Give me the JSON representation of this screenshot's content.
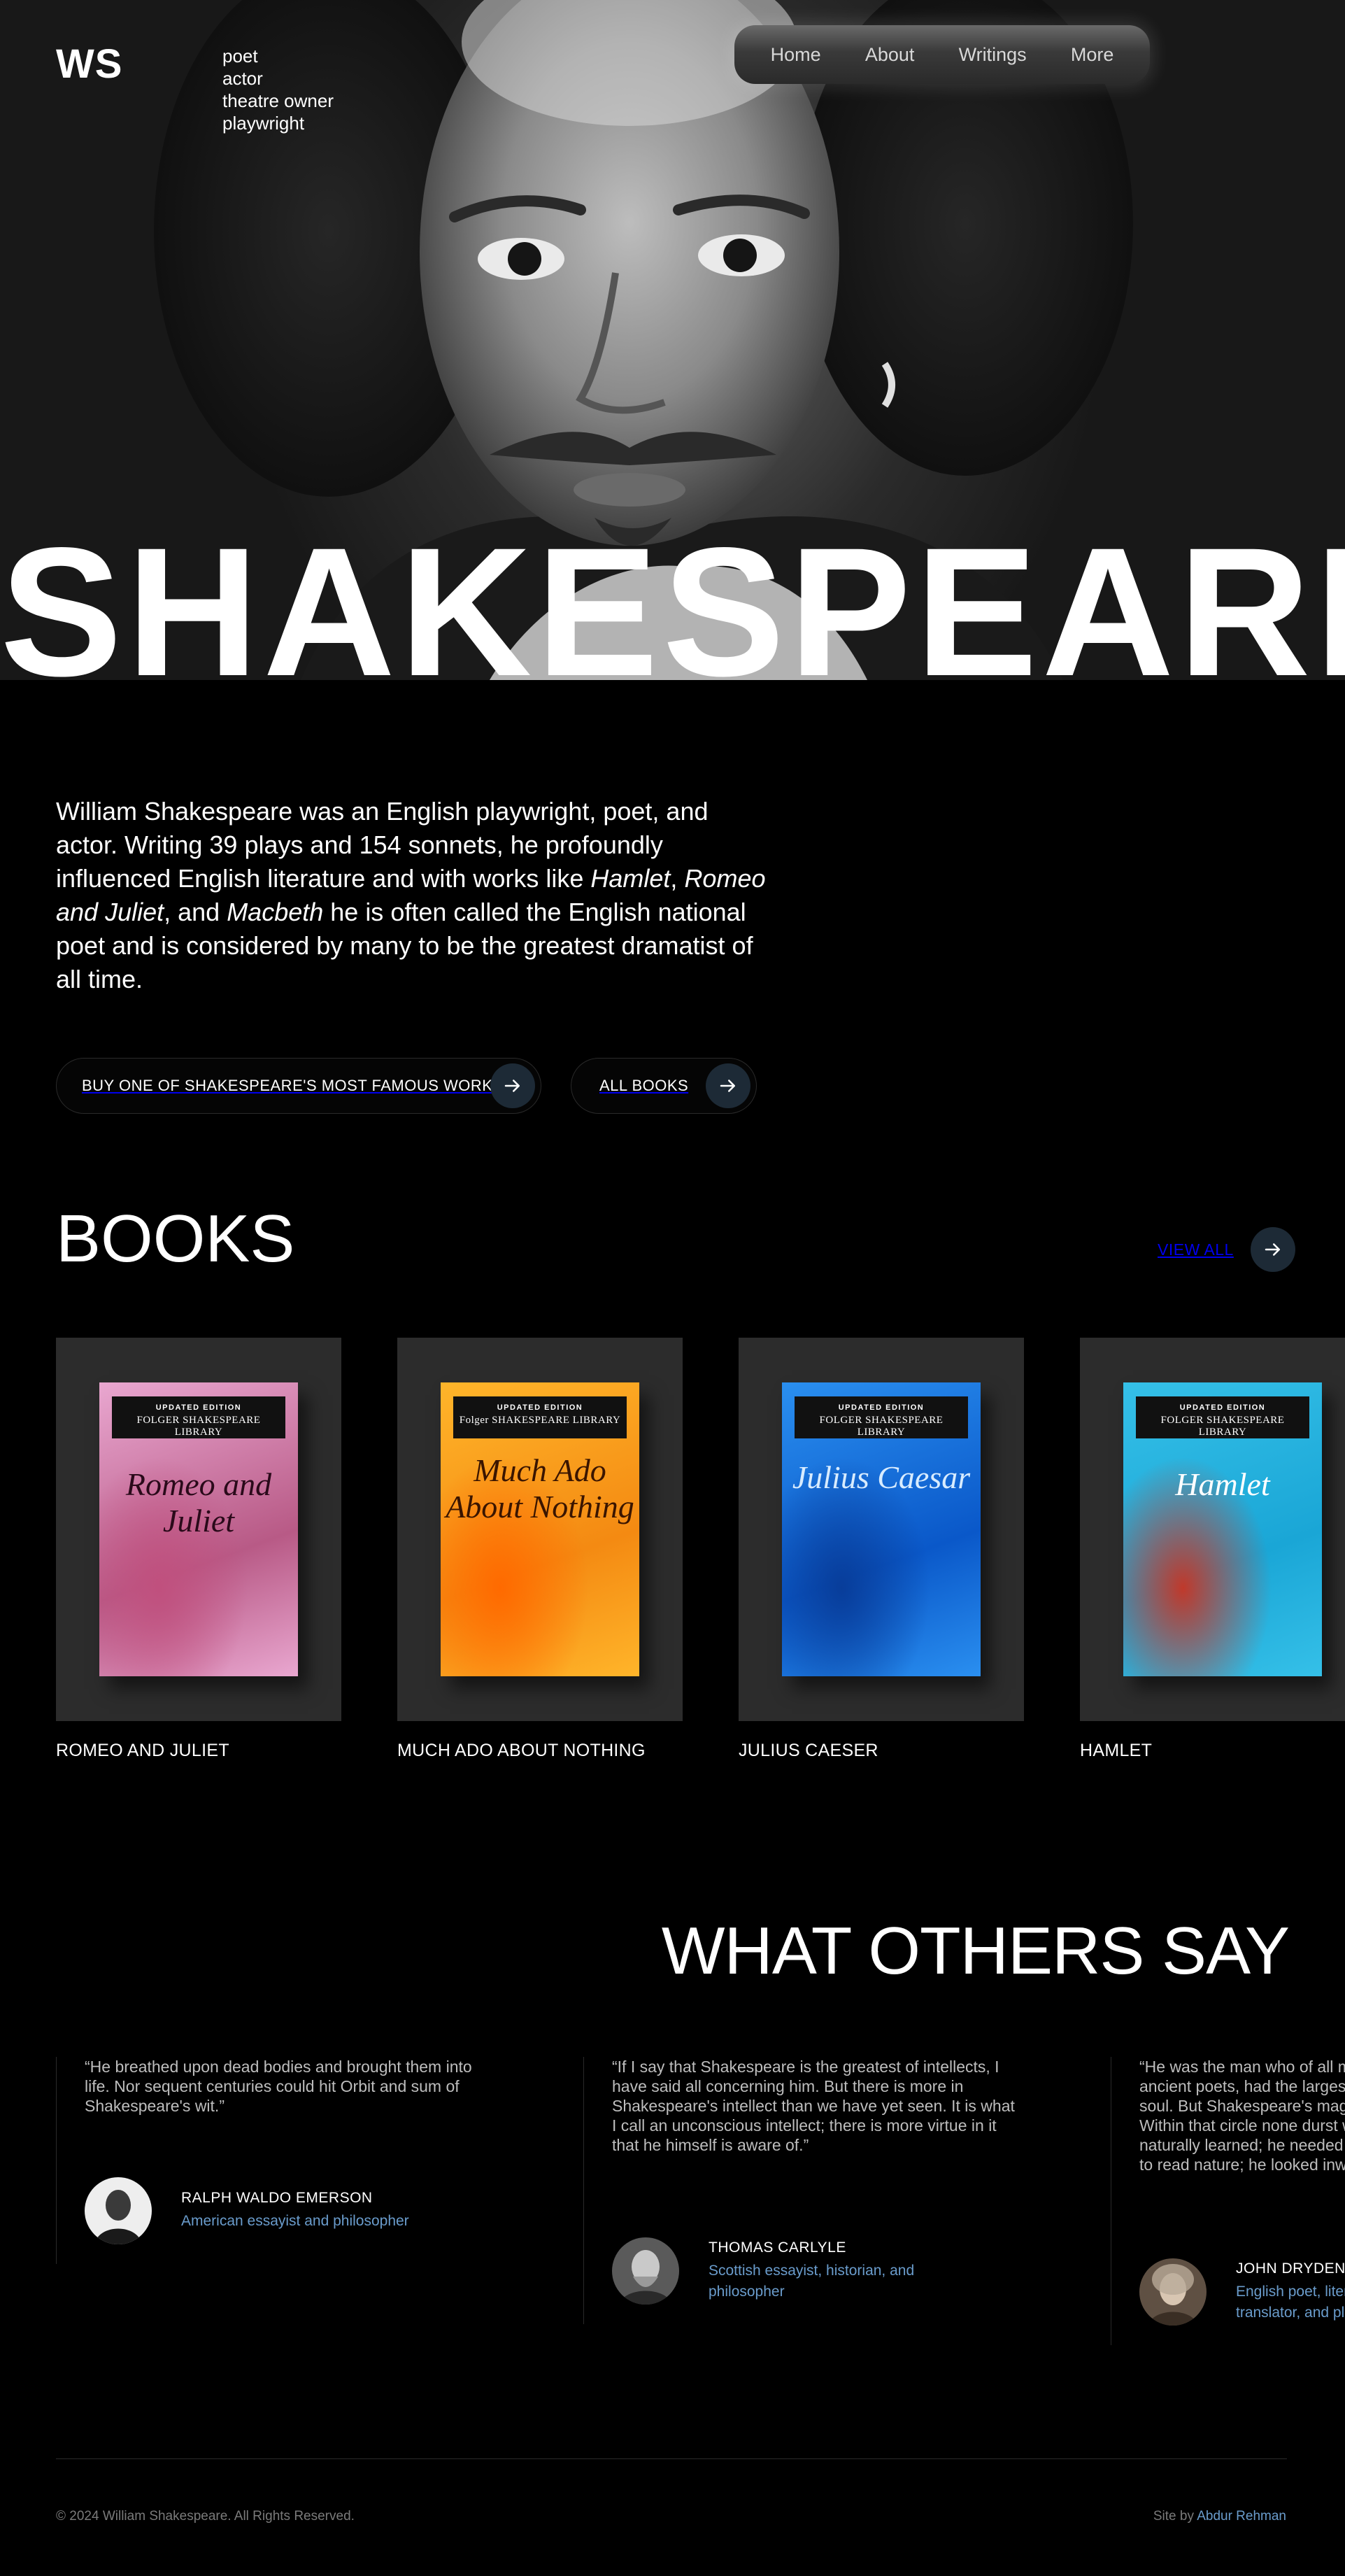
{
  "header": {
    "logo": "WS",
    "roles": [
      "poet",
      "actor",
      "theatre owner",
      "playwright"
    ],
    "nav": [
      "Home",
      "About",
      "Writings",
      "More"
    ]
  },
  "hero": {
    "wordmark": "SHAKESPEARE"
  },
  "intro": {
    "text_1": "William Shakespeare was an English playwright, poet, and actor. Writing 39 plays and 154 sonnets, he profoundly influenced English literature and with works like ",
    "work_1": "Hamlet",
    "sep_1": ", ",
    "work_2": "Romeo and Juliet",
    "sep_2": ", and ",
    "work_3": "Macbeth",
    "text_2": " he is often called the English national poet and is considered by many to be the greatest dramatist of all time."
  },
  "cta": {
    "buy_label": "BUY ONE OF SHAKESPEARE'S MOST FAMOUS WORK",
    "all_books_label": "ALL BOOKS"
  },
  "books": {
    "title": "BOOKS",
    "view_all": "VIEW ALL",
    "items": [
      {
        "name": "ROMEO AND JULIET",
        "cover_title": "Romeo and Juliet",
        "cover_edition": "UPDATED EDITION",
        "cover_series": "FOLGER SHAKESPEARE LIBRARY",
        "cover_colors": [
          "#b85a86",
          "#e9a7d0",
          "#c0507e"
        ]
      },
      {
        "name": "MUCH ADO ABOUT NOTHING",
        "cover_title": "Much Ado About Nothing",
        "cover_edition": "UPDATED EDITION",
        "cover_series": "Folger SHAKESPEARE LIBRARY",
        "cover_colors": [
          "#f48a12",
          "#ffb52a",
          "#ff6a00"
        ]
      },
      {
        "name": "JULIUS CAESER",
        "cover_title": "Julius Caesar",
        "cover_edition": "UPDATED EDITION",
        "cover_series": "FOLGER SHAKESPEARE LIBRARY",
        "cover_colors": [
          "#0a58c9",
          "#2a8ff0",
          "#083d9a"
        ]
      },
      {
        "name": "HAMLET",
        "cover_title": "Hamlet",
        "cover_edition": "UPDATED EDITION",
        "cover_series": "FOLGER SHAKESPEARE LIBRARY",
        "cover_colors": [
          "#1aa6d6",
          "#35c0e8",
          "#c0392b"
        ]
      }
    ]
  },
  "testimonials": {
    "title": "WHAT OTHERS SAY",
    "items": [
      {
        "quote": "“He breathed upon dead bodies and brought them into life. Nor sequent centuries could hit Orbit and sum of Shakespeare's wit.”",
        "name": "RALPH WALDO EMERSON",
        "role": "American essayist and philosopher"
      },
      {
        "quote": "“If I say that Shakespeare is the greatest of intellects, I have said all concerning him. But there is more in Shakespeare's intellect than we have yet seen. It is what I call an unconscious intellect; there is more virtue in it that he himself is aware of.”",
        "name": "THOMAS CARLYLE",
        "role": "Scottish essayist, historian, and philosopher"
      },
      {
        "quote": "“He was the man who of all modern, and perhaps ancient poets, had the largest and most comprehensive soul. But Shakespeare's magic could not copied be; Within that circle none durst walk but he. He was naturally learned; he needed not the spectacles of books to read nature; he looked inwards, and found her there.”",
        "name": "JOHN DRYDEN",
        "role": "English poet, literary critic, translator, and playwright"
      }
    ]
  },
  "footer": {
    "copyright": "© 2024 William Shakespeare. All Rights Reserved.",
    "credit_prefix": "Site by",
    "credit_name": "Abdur Rehman"
  },
  "colors": {
    "accent": "#6a9ccc",
    "button_circle": "#1d2a36",
    "card_bg": "#2c2c2c"
  }
}
